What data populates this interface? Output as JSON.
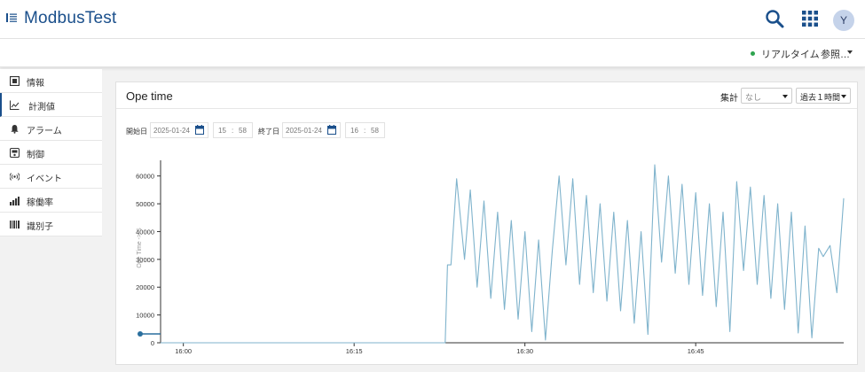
{
  "app": {
    "title": "ModbusTest",
    "avatar_initial": "Y"
  },
  "topbar": {
    "icons": [
      "menu-icon",
      "search-icon",
      "apps-grid-icon"
    ]
  },
  "subbar": {
    "realtime_label": "リアルタイム",
    "reference_label": "参照…",
    "realtime_status_color": "#2ea44f"
  },
  "sidebar": {
    "items": [
      {
        "label": "情報",
        "icon": "info-icon",
        "active": false
      },
      {
        "label": "計測値",
        "icon": "chart-line-icon",
        "active": true
      },
      {
        "label": "アラーム",
        "icon": "bell-icon",
        "active": false
      },
      {
        "label": "制御",
        "icon": "control-icon",
        "active": false
      },
      {
        "label": "イベント",
        "icon": "broadcast-icon",
        "active": false
      },
      {
        "label": "稼働率",
        "icon": "bar-chart-icon",
        "active": false
      },
      {
        "label": "識別子",
        "icon": "barcode-icon",
        "active": false
      }
    ]
  },
  "panel": {
    "title": "Ope time",
    "aggregate_label": "集計",
    "aggregate_value": "なし",
    "period_value": "過去１時間"
  },
  "filters": {
    "start_label": "開始日",
    "start_date": "2025-01-24",
    "start_hour": "15",
    "start_minute": "58",
    "end_label": "終了日",
    "end_date": "2025-01-24",
    "end_hour": "16",
    "end_minute": "58",
    "time_separator": ":"
  },
  "chart_data": {
    "type": "line",
    "ylabel": "Ope Time -> S",
    "ylim": [
      0,
      65000
    ],
    "y_ticks": [
      "0",
      "10000",
      "20000",
      "30000",
      "40000",
      "50000",
      "60000"
    ],
    "x_ticks": [
      "16:00",
      "16:15",
      "16:30",
      "16:45"
    ],
    "x_unit": "minutes after 15:58",
    "line_color": "#7fb3cc",
    "x": [
      0,
      25,
      25.2,
      25.5,
      26,
      26.7,
      27.2,
      27.8,
      28.4,
      29,
      29.6,
      30.2,
      30.8,
      31.4,
      32,
      32.6,
      33.2,
      33.8,
      34.4,
      35,
      35.6,
      36.2,
      36.8,
      37.4,
      38,
      38.6,
      39.2,
      39.8,
      40.4,
      41,
      41.6,
      42.2,
      42.8,
      43.4,
      44,
      44.6,
      45.2,
      45.8,
      46.4,
      47,
      47.6,
      48.2,
      48.8,
      49.4,
      50,
      50.6,
      51.2,
      51.8,
      52.4,
      53,
      53.6,
      54.2,
      54.8,
      55.4,
      56,
      56.6,
      57.2,
      57.8,
      58.2,
      58.8,
      59.4,
      60
    ],
    "values": [
      0,
      0,
      28000,
      28000,
      59000,
      30000,
      55000,
      20000,
      51000,
      16000,
      47000,
      12000,
      44000,
      8500,
      40000,
      4000,
      37000,
      1000,
      33000,
      60000,
      28000,
      59000,
      21000,
      53000,
      18000,
      50000,
      15000,
      47000,
      11500,
      44000,
      7000,
      40000,
      3000,
      64000,
      29000,
      60000,
      25000,
      57000,
      21000,
      54000,
      17000,
      50000,
      13000,
      47000,
      4000,
      58000,
      26000,
      56000,
      21000,
      53000,
      16000,
      50000,
      12000,
      47000,
      3500,
      42000,
      1800,
      34000,
      31000,
      35000,
      18000,
      52000
    ]
  }
}
